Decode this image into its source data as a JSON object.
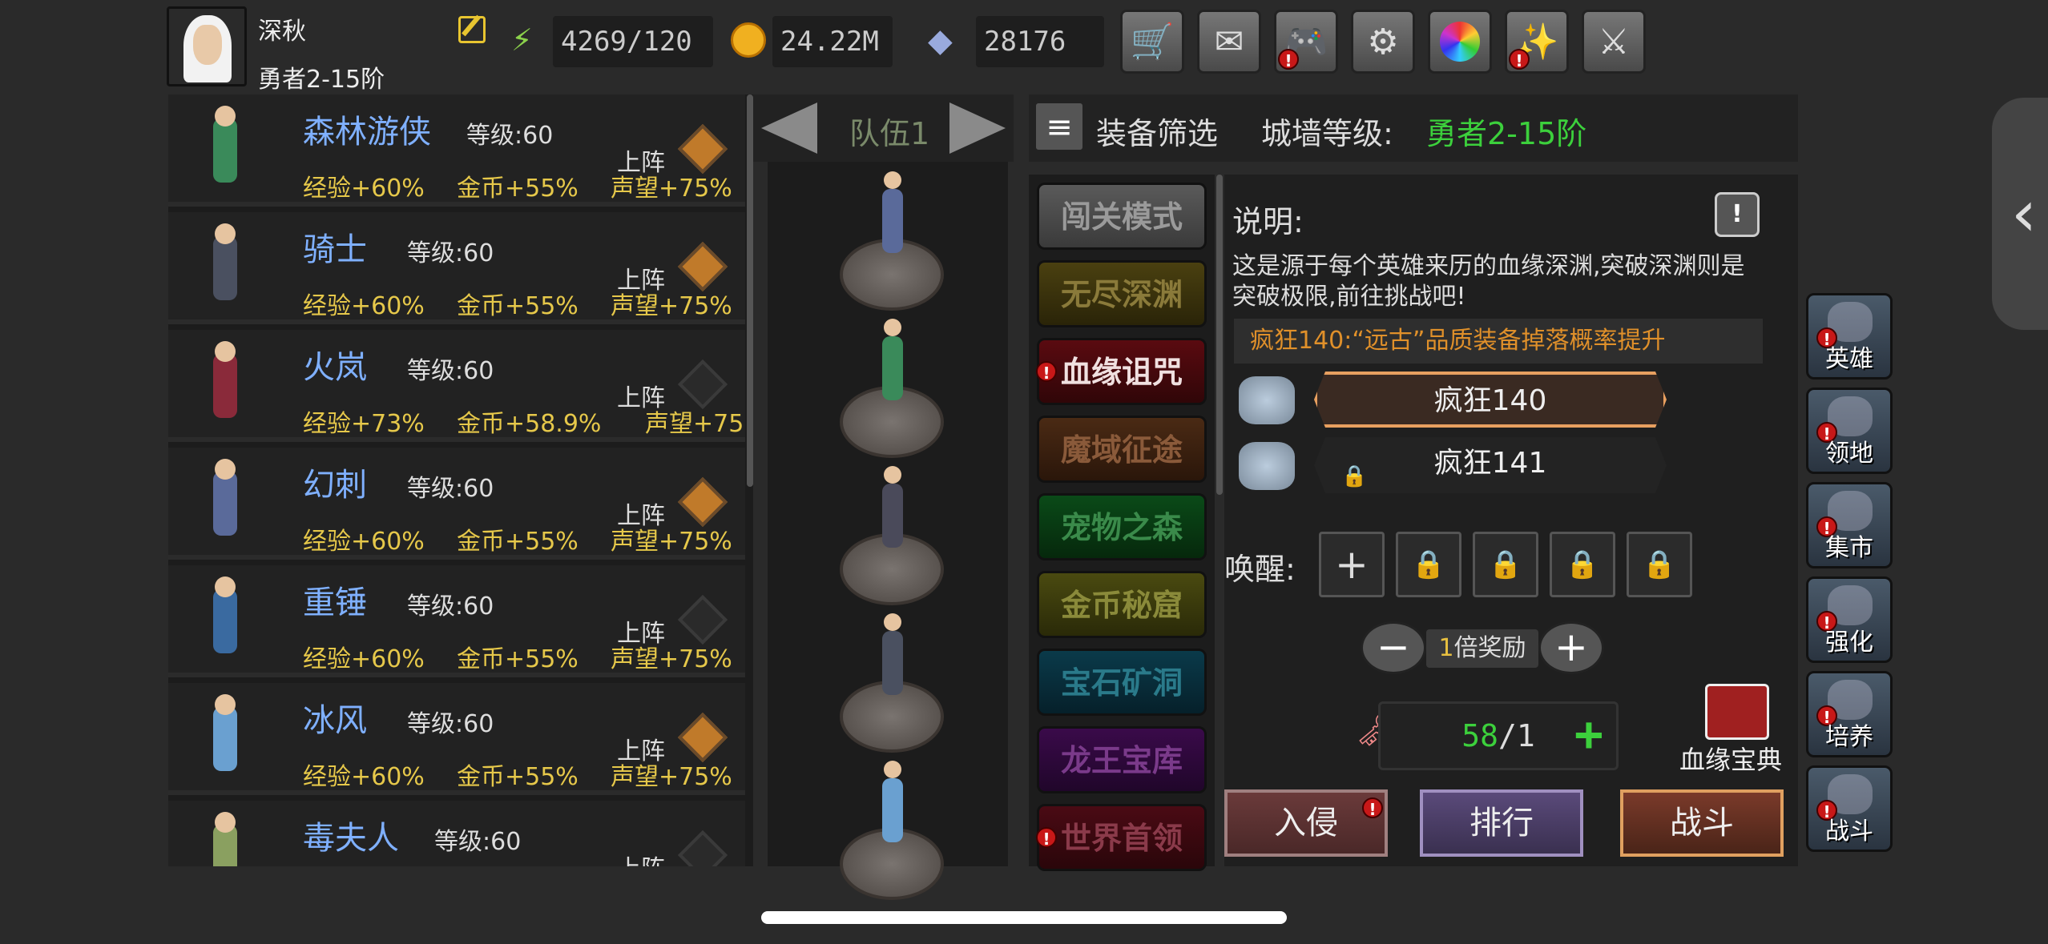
{
  "player": {
    "name": "深秋",
    "rank": "勇者2-15阶"
  },
  "resources": {
    "energy": "4269/120",
    "gold": "24.22M",
    "gems": "28176"
  },
  "top_icons": [
    "cart-icon",
    "mail-icon",
    "gamepad-icon",
    "gear-icon",
    "color-wheel-icon",
    "sparkle-icon",
    "swords-icon"
  ],
  "heroes": [
    {
      "name": "森林游侠",
      "level": "等级:60",
      "exp": "经验+60%",
      "gold": "金币+55%",
      "fame": "声望+75%",
      "deploy": "上阵",
      "active": true
    },
    {
      "name": "骑士",
      "level": "等级:60",
      "exp": "经验+60%",
      "gold": "金币+55%",
      "fame": "声望+75%",
      "deploy": "上阵",
      "active": true
    },
    {
      "name": "火岚",
      "level": "等级:60",
      "exp": "经验+73%",
      "gold": "金币+58.9%",
      "fame": "声望+75",
      "deploy": "上阵",
      "active": false
    },
    {
      "name": "幻刺",
      "level": "等级:60",
      "exp": "经验+60%",
      "gold": "金币+55%",
      "fame": "声望+75%",
      "deploy": "上阵",
      "active": true
    },
    {
      "name": "重锤",
      "level": "等级:60",
      "exp": "经验+60%",
      "gold": "金币+55%",
      "fame": "声望+75%",
      "deploy": "上阵",
      "active": false
    },
    {
      "name": "冰风",
      "level": "等级:60",
      "exp": "经验+60%",
      "gold": "金币+55%",
      "fame": "声望+75%",
      "deploy": "上阵",
      "active": true
    },
    {
      "name": "毒夫人",
      "level": "等级:60",
      "exp": "",
      "gold": "",
      "fame": "",
      "deploy": "上阵",
      "active": false
    }
  ],
  "team": {
    "label": "队伍1"
  },
  "filter": {
    "label": "装备筛选",
    "wall_label": "城墙等级:",
    "wall_value": "勇者2-15阶"
  },
  "modes": [
    "闯关模式",
    "无尽深渊",
    "血缘诅咒",
    "魔域征途",
    "宠物之森",
    "金币秘窟",
    "宝石矿洞",
    "龙王宝库",
    "世界首领"
  ],
  "detail": {
    "label": "说明:",
    "help": "!",
    "description": "这是源于每个英雄来历的血缘深渊,突破深渊则是突破极限,前往挑战吧!",
    "banner": "疯狂140:“远古”品质装备掉落概率提升",
    "level1": "疯狂140",
    "level2": "疯狂141",
    "awaken_label": "唤醒:",
    "reward_num": "1",
    "reward_text": "倍奖励",
    "counter_num": "58",
    "counter_rest": "/1",
    "book_label": "血缘宝典",
    "btn_invade": "入侵",
    "btn_rank": "排行",
    "btn_fight": "战斗"
  },
  "side_nav": [
    "英雄",
    "领地",
    "集市",
    "强化",
    "培养",
    "战斗"
  ],
  "colors": {
    "accent_green": "#3cd03c",
    "hero_name": "#7fb0ff",
    "stat_gold": "#e6c84a",
    "banner_orange": "#e0902a"
  }
}
